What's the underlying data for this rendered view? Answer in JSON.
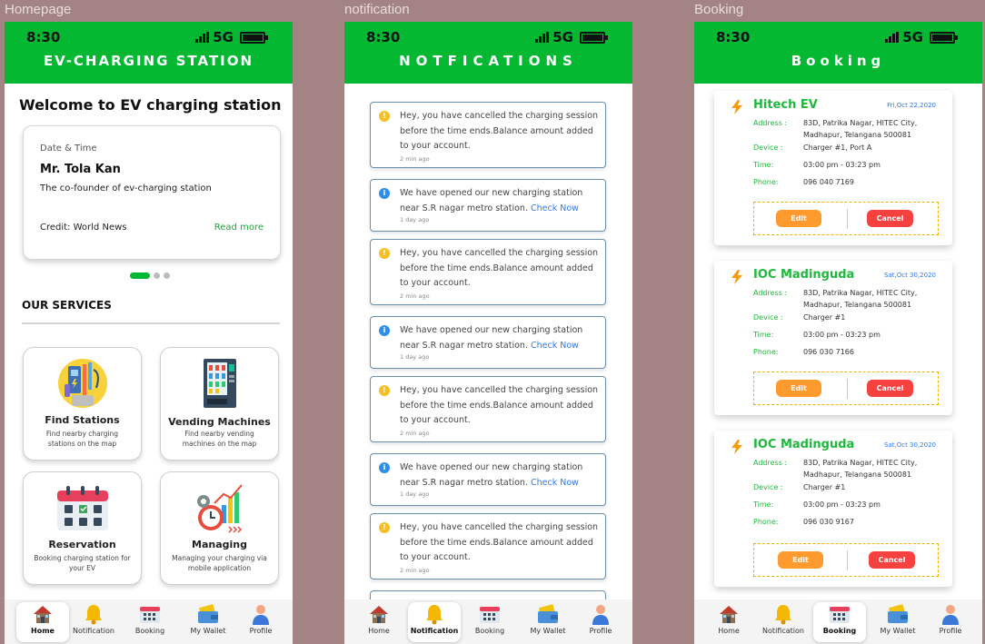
{
  "frames": {
    "home_label": "Homepage",
    "notif_label": "notification",
    "booking_label": "Booking"
  },
  "status": {
    "time": "8:30",
    "network": "5G"
  },
  "home": {
    "header_title": "EV-CHARGING STATION",
    "welcome": "Welcome to EV charging station",
    "card": {
      "date_time": "Date & Time",
      "name": "Mr. Tola Kan",
      "description": "The co-founder of ev-charging station",
      "credit": "Credit: World News",
      "read_more": "Read more"
    },
    "carousel": {
      "page_count": 3,
      "active_index": 0
    },
    "services_title": "OUR SERVICES",
    "services": [
      {
        "title": "Find Stations",
        "subtitle": "Find nearby charging stations on the map",
        "icon": "charging-station-icon"
      },
      {
        "title": "Vending Machines",
        "subtitle": "Find nearby vending machines on the map",
        "icon": "vending-machine-icon"
      },
      {
        "title": "Reservation",
        "subtitle": "Booking charging station for your EV",
        "icon": "calendar-icon"
      },
      {
        "title": "Managing",
        "subtitle": "Managing your charging via mobile application",
        "icon": "analytics-icon"
      }
    ]
  },
  "notifications": {
    "header_title": "NOTFICATIONS",
    "cancel_msg": "Hey, you have cancelled the charging session before the time ends.Balance amount added to your account.",
    "open_msg": "We have opened our new charging station near S.R nagar metro station.",
    "check_now": "Check Now",
    "items": [
      {
        "type": "warning",
        "ago": "2 min ago"
      },
      {
        "type": "info",
        "ago": "1 day ago"
      },
      {
        "type": "warning",
        "ago": "2 min ago"
      },
      {
        "type": "info",
        "ago": "1 day ago"
      },
      {
        "type": "warning",
        "ago": "2 min ago"
      },
      {
        "type": "info",
        "ago": "1 day ago"
      },
      {
        "type": "warning",
        "ago": "2 min ago"
      },
      {
        "type": "info",
        "ago": ""
      }
    ]
  },
  "booking": {
    "header_title": "Booking",
    "labels": {
      "address": "Address :",
      "device": "Device :",
      "time": "Time:",
      "phone": "Phone:"
    },
    "edit_label": "Edit",
    "cancel_label": "Cancel",
    "items": [
      {
        "name": "Hitech EV",
        "date": "Fri,Oct 22,2020",
        "address": "83D, Patrika Nagar, HITEC City, Madhapur, Telangana 500081",
        "device": "Charger #1, Port A",
        "time": "03:00 pm - 03:23 pm",
        "phone": "096 040 7169"
      },
      {
        "name": "IOC Madinguda",
        "date": "Sat,Oct 30,2020",
        "address": "83D, Patrika Nagar, HITEC City, Madhapur, Telangana 500081",
        "device": "Charger #1",
        "time": "03:00 pm - 03:23 pm",
        "phone": "096 030 7166"
      },
      {
        "name": "IOC Madinguda",
        "date": "Sat,Oct 30,2020",
        "address": "83D, Patrika Nagar, HITEC City, Madhapur, Telangana 500081",
        "device": "Charger #1",
        "time": "03:00 pm - 03:23 pm",
        "phone": "096 030 9167"
      }
    ]
  },
  "nav": {
    "home": "Home",
    "notification": "Notification",
    "booking": "Booking",
    "wallet": "My Wallet",
    "profile": "Profile"
  },
  "colors": {
    "brand_green": "#04b832",
    "link_blue": "#2f7ae5",
    "warning_yellow": "#f5c026",
    "info_blue": "#2e8ee8",
    "edit_orange": "#ff9a2e",
    "cancel_red": "#f5423f",
    "canvas": "#a38383"
  }
}
